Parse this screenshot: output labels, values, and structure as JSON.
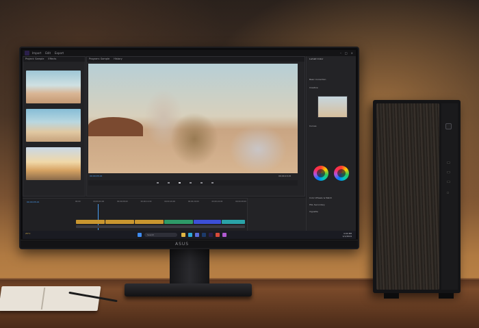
{
  "scene": "desk-setup",
  "monitor": {
    "chin_logo": "ASUS",
    "app": {
      "menu": [
        "Import",
        "Edit",
        "Export"
      ],
      "title": "",
      "project_tabs": [
        "Project: Sample",
        "Effects"
      ],
      "viewer_tabs": [
        "Program: Sample",
        "History"
      ],
      "viewer_timecode_left": "00;00;05;24",
      "viewer_timecode_right": "00;00;13;15",
      "timeline_timecode": "00;00;05;24",
      "ruler_ticks": [
        "00;00",
        "00;00;04;00",
        "00;00;08;00",
        "00;00;12;00",
        "00;00;16;00",
        "00;00;20;00",
        "00;00;24;00",
        "00;00;28;00"
      ],
      "right_panel": {
        "header": "Lumetri Color",
        "rows": [
          "Basic Correction",
          "Creative",
          "Curves",
          "Color Wheels & Match",
          "HSL Secondary",
          "Vignette"
        ]
      }
    },
    "taskbar": {
      "search_placeholder": "Search",
      "weather": "25°C",
      "clock_time": "4:00 PM",
      "clock_date": "1/1/2024"
    }
  },
  "colors": {
    "track_gold": "#c9962f",
    "track_green": "#2e9a67",
    "track_blue": "#3c4fd6",
    "track_teal": "#2aa3a8",
    "accent_purple": "#2a1f4a"
  }
}
